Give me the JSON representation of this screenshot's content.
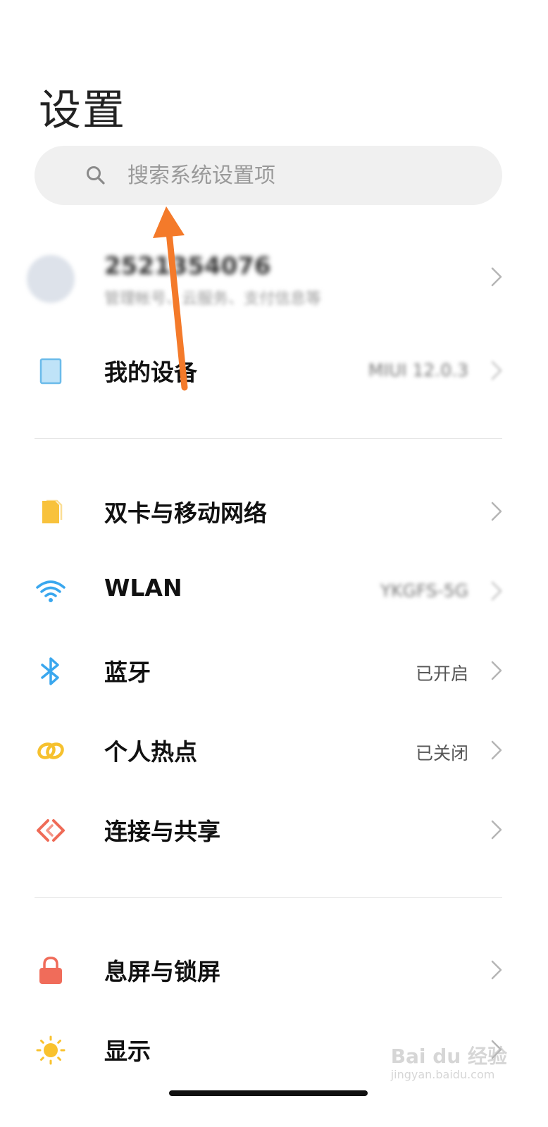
{
  "header": {
    "title": "设置"
  },
  "search": {
    "placeholder": "搜索系统设置项",
    "icon": "search-icon"
  },
  "account": {
    "name": "2521354076",
    "subtitle": "管理帐号、云服务、支付信息等"
  },
  "my_device": {
    "label": "我的设备",
    "value": "MIUI 12.0.3"
  },
  "network_section": [
    {
      "label": "双卡与移动网络",
      "value": "",
      "icon": "sim-card-icon"
    },
    {
      "label": "WLAN",
      "value": "YKGFS-5G",
      "icon": "wifi-icon"
    },
    {
      "label": "蓝牙",
      "value": "已开启",
      "icon": "bluetooth-icon"
    },
    {
      "label": "个人热点",
      "value": "已关闭",
      "icon": "hotspot-icon"
    },
    {
      "label": "连接与共享",
      "value": "",
      "icon": "share-icon"
    }
  ],
  "display_section": [
    {
      "label": "息屏与锁屏",
      "value": "",
      "icon": "lock-icon"
    },
    {
      "label": "显示",
      "value": "",
      "icon": "sun-icon"
    }
  ],
  "watermark": {
    "brand": "Bai du 经验",
    "url": "jingyan.baidu.com"
  },
  "colors": {
    "arrow": "#f47a2a",
    "sim": "#f8c23c",
    "wifi": "#3aa7ee",
    "bluetooth": "#3aa7ee",
    "hotspot": "#f6c12e",
    "share": "#ef6b57",
    "lock": "#f06c5a",
    "sun": "#f9c22e",
    "device": "#6bbbea"
  }
}
